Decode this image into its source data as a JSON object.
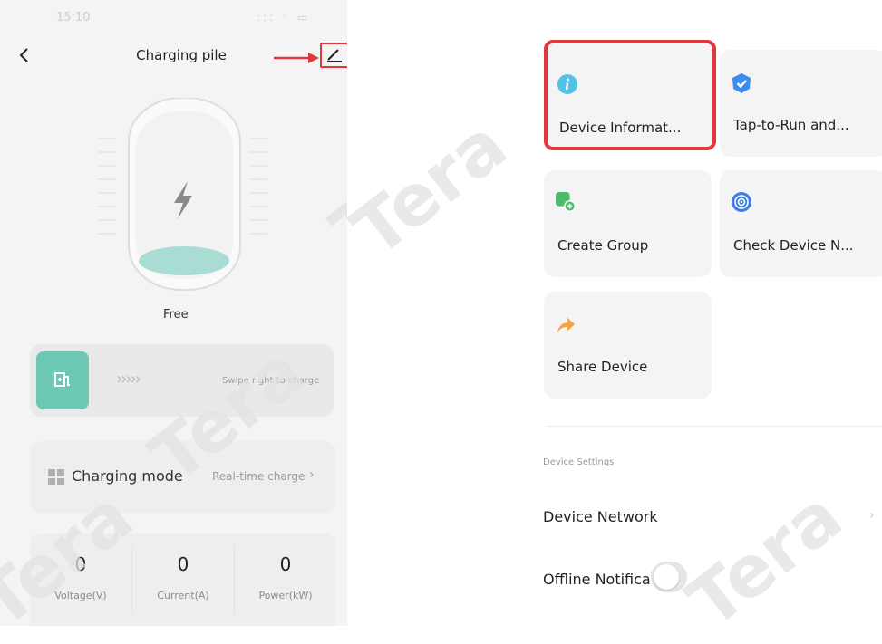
{
  "status_bar": {
    "time": "15:10",
    "indicators": "::: ◦ ▭"
  },
  "header": {
    "title": "Charging pile",
    "back_icon": "chevron-left-icon",
    "edit_icon": "pencil-icon"
  },
  "charger": {
    "status": "Free",
    "icon": "lightning-bolt-icon"
  },
  "swipe": {
    "icon": "ev-charger-icon",
    "chevrons": "›››››",
    "hint": "Swipe right to charge"
  },
  "charging_mode": {
    "label": "Charging mode",
    "value": "Real-time charge",
    "chevron": "›",
    "icon": "grid-icon"
  },
  "metrics": [
    {
      "value": "0",
      "label": "Voltage(V)"
    },
    {
      "value": "0",
      "label": "Current(A)"
    },
    {
      "value": "0",
      "label": "Power(kW)"
    }
  ],
  "watermark": "Tera",
  "tiles": [
    {
      "label": "Device Informat...",
      "icon": "info-icon",
      "color": "#4fc3e8",
      "selected": true
    },
    {
      "label": "Tap-to-Run and...",
      "icon": "check-shield-icon",
      "color": "#3b8cf0",
      "selected": false
    },
    {
      "label": "Create Group",
      "icon": "add-group-icon",
      "color": "#4cbb6a",
      "selected": false
    },
    {
      "label": "Check Device N...",
      "icon": "network-check-icon",
      "color": "#3c7ef0",
      "selected": false
    },
    {
      "label": "Share Device",
      "icon": "share-arrow-icon",
      "color": "#f4a340",
      "selected": false
    }
  ],
  "settings": {
    "section_title": "Device Settings",
    "rows": [
      {
        "label": "Device Network",
        "chevron": "›"
      },
      {
        "label": "Offline Notification",
        "toggle_on": false
      }
    ]
  },
  "colors": {
    "accent_teal": "#6cc7b3",
    "annotation_red": "#e2383d",
    "panel_bg": "#f4f4f4"
  }
}
